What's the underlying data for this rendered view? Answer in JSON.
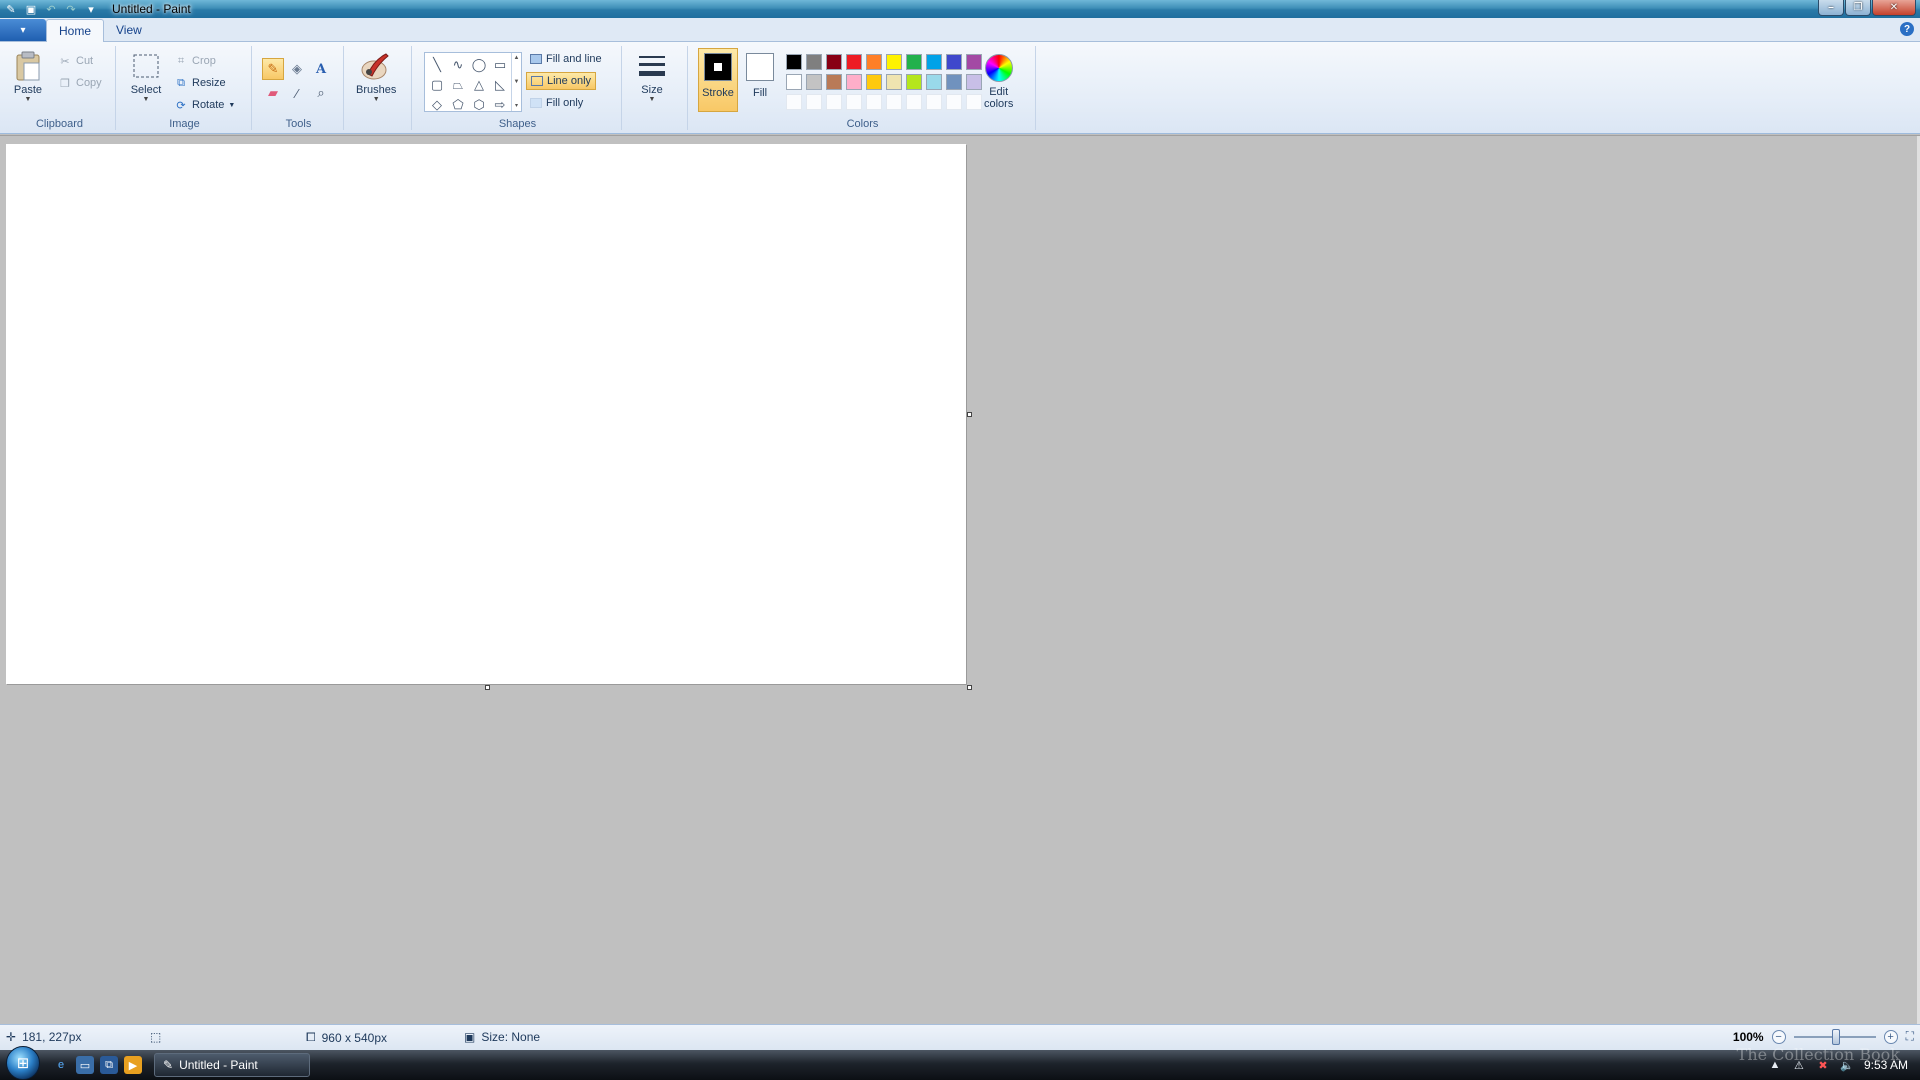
{
  "window": {
    "title": "Untitled - Paint"
  },
  "tabs": [
    {
      "label": "Home"
    },
    {
      "label": "View"
    }
  ],
  "clipboard": {
    "label": "Clipboard",
    "paste": "Paste",
    "cut": "Cut",
    "copy": "Copy"
  },
  "image": {
    "label": "Image",
    "select": "Select",
    "crop": "Crop",
    "resize": "Resize",
    "rotate": "Rotate"
  },
  "tools": {
    "label": "Tools"
  },
  "brushes": {
    "label": "Brushes"
  },
  "shapes": {
    "label": "Shapes",
    "fill_and_line": "Fill and line",
    "line_only": "Line only",
    "fill_only": "Fill only"
  },
  "size": {
    "label": "Size"
  },
  "colors": {
    "label": "Colors",
    "stroke": "Stroke",
    "fill": "Fill",
    "edit_colors_1": "Edit",
    "edit_colors_2": "colors",
    "stroke_color": "#000000",
    "fill_color": "#ffffff",
    "palette_row1": [
      "#000000",
      "#7f7f7f",
      "#880015",
      "#ed1c24",
      "#ff7f27",
      "#fff200",
      "#22b14c",
      "#00a2e8",
      "#3f48cc",
      "#a349a4"
    ],
    "palette_row2": [
      "#ffffff",
      "#c3c3c3",
      "#b97a57",
      "#ffaec9",
      "#ffc90e",
      "#efe4b0",
      "#b5e61d",
      "#99d9ea",
      "#7092be",
      "#c8bfe7"
    ]
  },
  "status": {
    "cursor": "181, 227px",
    "image_size": "960 x 540px",
    "file_size": "Size: None",
    "zoom": "100%"
  },
  "taskbar": {
    "task_label": "Untitled - Paint",
    "clock": "9:53 AM"
  },
  "watermark": "The Collection Book"
}
